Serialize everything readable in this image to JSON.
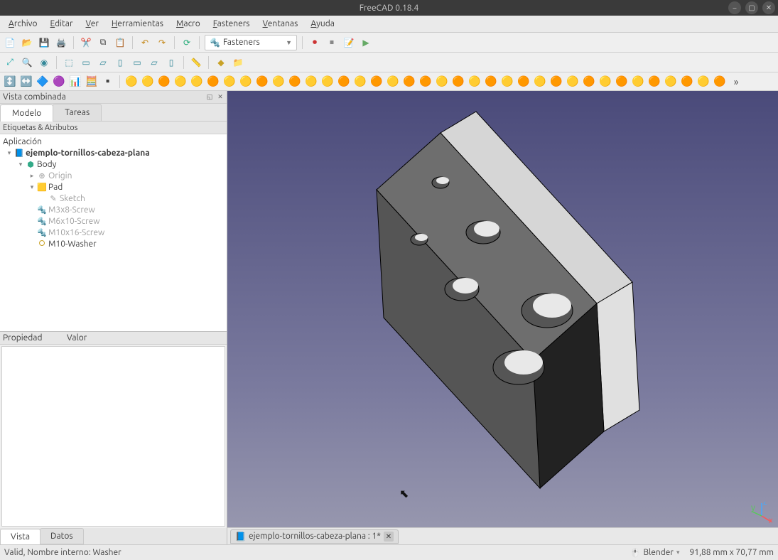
{
  "title": "FreeCAD 0.18.4",
  "menu": [
    "Archivo",
    "Editar",
    "Ver",
    "Herramientas",
    "Macro",
    "Fasteners",
    "Ventanas",
    "Ayuda"
  ],
  "workbench": {
    "label": "Fasteners"
  },
  "combo_view": {
    "title": "Vista combinada",
    "tabs": {
      "model": "Modelo",
      "tasks": "Tareas"
    },
    "tree_header": "Etiquetas & Atributos",
    "root": "Aplicación",
    "doc": "ejemplo-tornillos-cabeza-plana",
    "body": "Body",
    "origin": "Origin",
    "pad": "Pad",
    "sketch": "Sketch",
    "screws": [
      "M3x8-Screw",
      "M6x10-Screw",
      "M10x16-Screw"
    ],
    "washer": "M10-Washer"
  },
  "property": {
    "col1": "Propiedad",
    "col2": "Valor",
    "tabs": {
      "view": "Vista",
      "data": "Datos"
    }
  },
  "doc_tab": "ejemplo-tornillos-cabeza-plana : 1*",
  "status": {
    "msg": "Valid, Nombre interno: Washer",
    "nav": "Blender",
    "dims": "91,88 mm x 70,77 mm"
  },
  "axes": {
    "x": "x",
    "y": "y",
    "z": "z"
  }
}
